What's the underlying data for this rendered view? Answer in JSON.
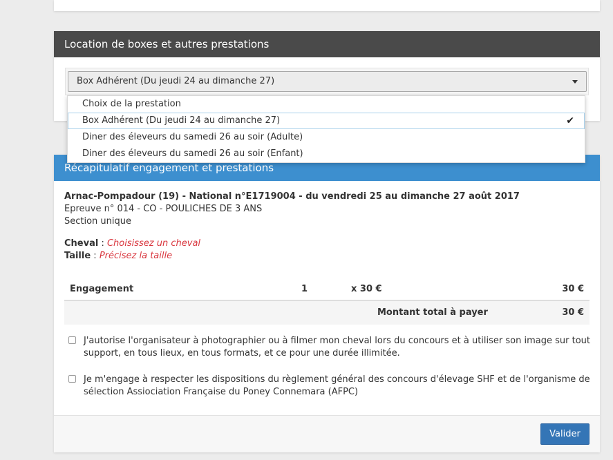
{
  "location": {
    "title": "Location de boxes et autres prestations",
    "select_value": "Box Adhérent (Du jeudi 24 au dimanche 27)",
    "options": [
      "Choix de la prestation",
      "Box Adhérent (Du jeudi 24 au dimanche 27)",
      "Diner des éleveurs du samedi 26 au soir (Adulte)",
      "Diner des éleveurs du samedi 26 au soir (Enfant)"
    ],
    "check_mark": "✔"
  },
  "recap": {
    "title": "Récapitulatif engagement et prestations",
    "event": "Arnac-Pompadour (19) - National n°E1719004 - du vendredi 25 au dimanche 27 août 2017",
    "epreuve": "Epreuve n° 014 - CO - POULICHES DE 3 ANS",
    "section": "Section unique",
    "cheval_label": "Cheval",
    "cheval_value": "Choisissez un cheval",
    "taille_label": "Taille",
    "taille_value": "Précisez la taille",
    "separator": " : ",
    "table": {
      "row_label": "Engagement",
      "qty": "1",
      "unit_price": "x 30 €",
      "amount": "30 €",
      "total_label": "Montant total à payer",
      "total_value": "30 €"
    },
    "consent_photo": "J'autorise l'organisateur à photographier ou à filmer mon cheval lors du concours et à utiliser son image sur tout support, en tous lieux, en tous formats, et ce pour une durée illimitée.",
    "consent_rules": "Je m'engage à respecter les dispositions du règlement général des concours d'élevage SHF et de l'organisme de sélection Assiociation Française du Poney Connemara (AFPC)",
    "submit_label": "Valider"
  },
  "colors": {
    "location_header_bg": "#4a4a4a",
    "recap_header_bg": "#3d8fcf",
    "button_bg": "#3475b6",
    "warning_text": "#d9363e"
  }
}
